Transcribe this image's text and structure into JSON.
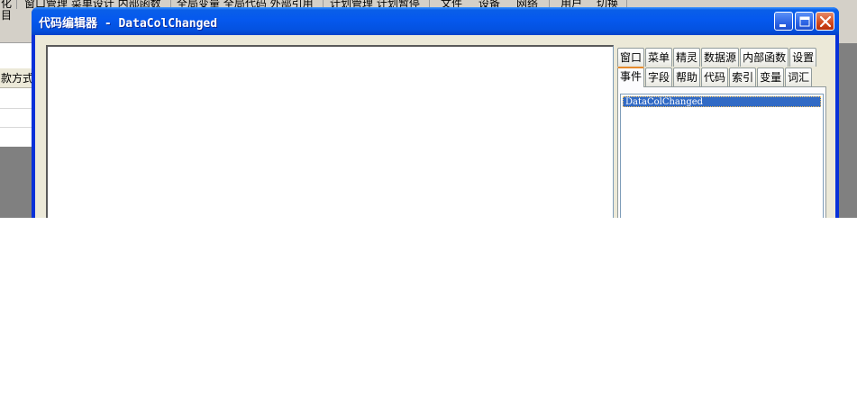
{
  "background_app": {
    "toolbar_labels": [
      "化",
      "窗口管理 菜单设计 内部函数",
      "全局变量 全局代码 外部引用",
      "计划管理 计划暂停",
      "文件",
      "设备",
      "网络",
      "用户",
      "切换"
    ],
    "left_label_line2": "目",
    "grid_header": "款方式"
  },
  "window": {
    "title": "代码编辑器 - DataColChanged",
    "buttons": {
      "minimize": "minimize",
      "maximize": "maximize",
      "close": "close"
    }
  },
  "tabs_row1": [
    "窗口",
    "菜单",
    "精灵",
    "数据源",
    "内部函数",
    "设置"
  ],
  "tabs_row2": [
    "事件",
    "字段",
    "帮助",
    "代码",
    "索引",
    "变量",
    "词汇"
  ],
  "active_tab": "事件",
  "event_list": [
    "DataColChanged"
  ],
  "colors": {
    "title_bar": "#0558ee",
    "selection": "#316ac5",
    "active_tab_accent": "#e68b2c"
  }
}
